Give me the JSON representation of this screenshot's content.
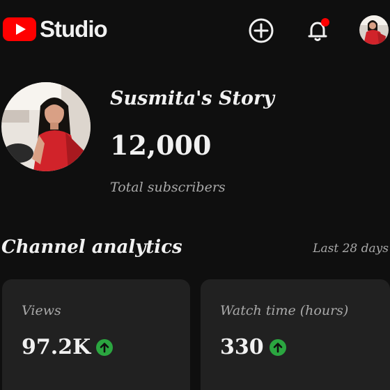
{
  "app": {
    "name": "Studio",
    "logo_icon": "youtube-play-icon",
    "brand_color": "#ff0000"
  },
  "header": {
    "create_icon": "plus-circle-icon",
    "notifications_icon": "bell-icon",
    "notification_dot_color": "#ff0000"
  },
  "channel": {
    "name": "Susmita's Story",
    "subscriber_count": "12,000",
    "subscriber_label": "Total subscribers"
  },
  "analytics": {
    "title": "Channel analytics",
    "period": "Last 28 days",
    "cards": [
      {
        "label": "Views",
        "value": "97.2K",
        "trend_icon": "arrow-up-circle-icon",
        "trend_color": "#2ba640"
      },
      {
        "label": "Watch time (hours)",
        "value": "330",
        "trend_icon": "arrow-up-circle-icon",
        "trend_color": "#2ba640"
      }
    ]
  }
}
